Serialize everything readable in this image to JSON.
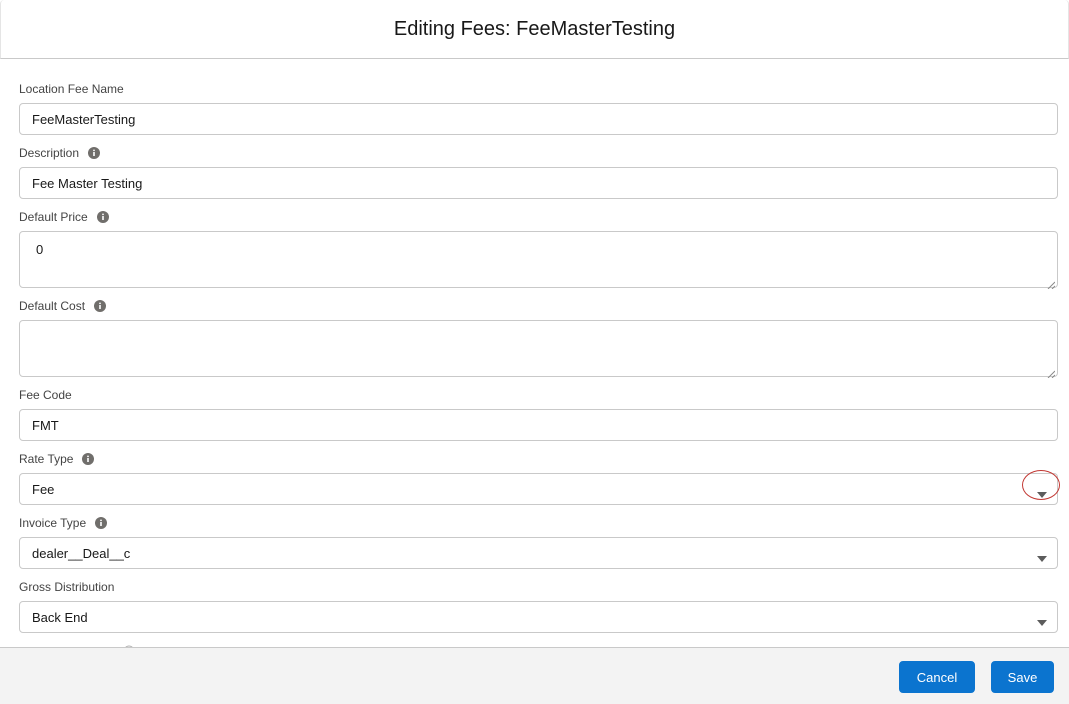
{
  "modal": {
    "title": "Editing Fees: FeeMasterTesting"
  },
  "fields": {
    "location_fee_name": {
      "label": "Location Fee Name",
      "value": "FeeMasterTesting"
    },
    "description": {
      "label": "Description",
      "value": "Fee Master Testing",
      "icon": "info-icon"
    },
    "default_price": {
      "label": "Default Price",
      "value": "0",
      "icon": "info-icon"
    },
    "default_cost": {
      "label": "Default Cost",
      "value": "",
      "icon": "info-icon"
    },
    "fee_code": {
      "label": "Fee Code",
      "value": "FMT"
    },
    "rate_type": {
      "label": "Rate Type",
      "value": "Fee",
      "icon": "info-icon"
    },
    "invoice_type": {
      "label": "Invoice Type",
      "value": "dealer__Deal__c",
      "icon": "info-icon"
    },
    "gross_distribution": {
      "label": "Gross Distribution",
      "value": "Back End"
    }
  },
  "footer": {
    "cancel_label": "Cancel",
    "save_label": "Save"
  },
  "colors": {
    "brand": "#0b74cf",
    "highlight": "#c23934",
    "border": "#c9c9c9"
  }
}
